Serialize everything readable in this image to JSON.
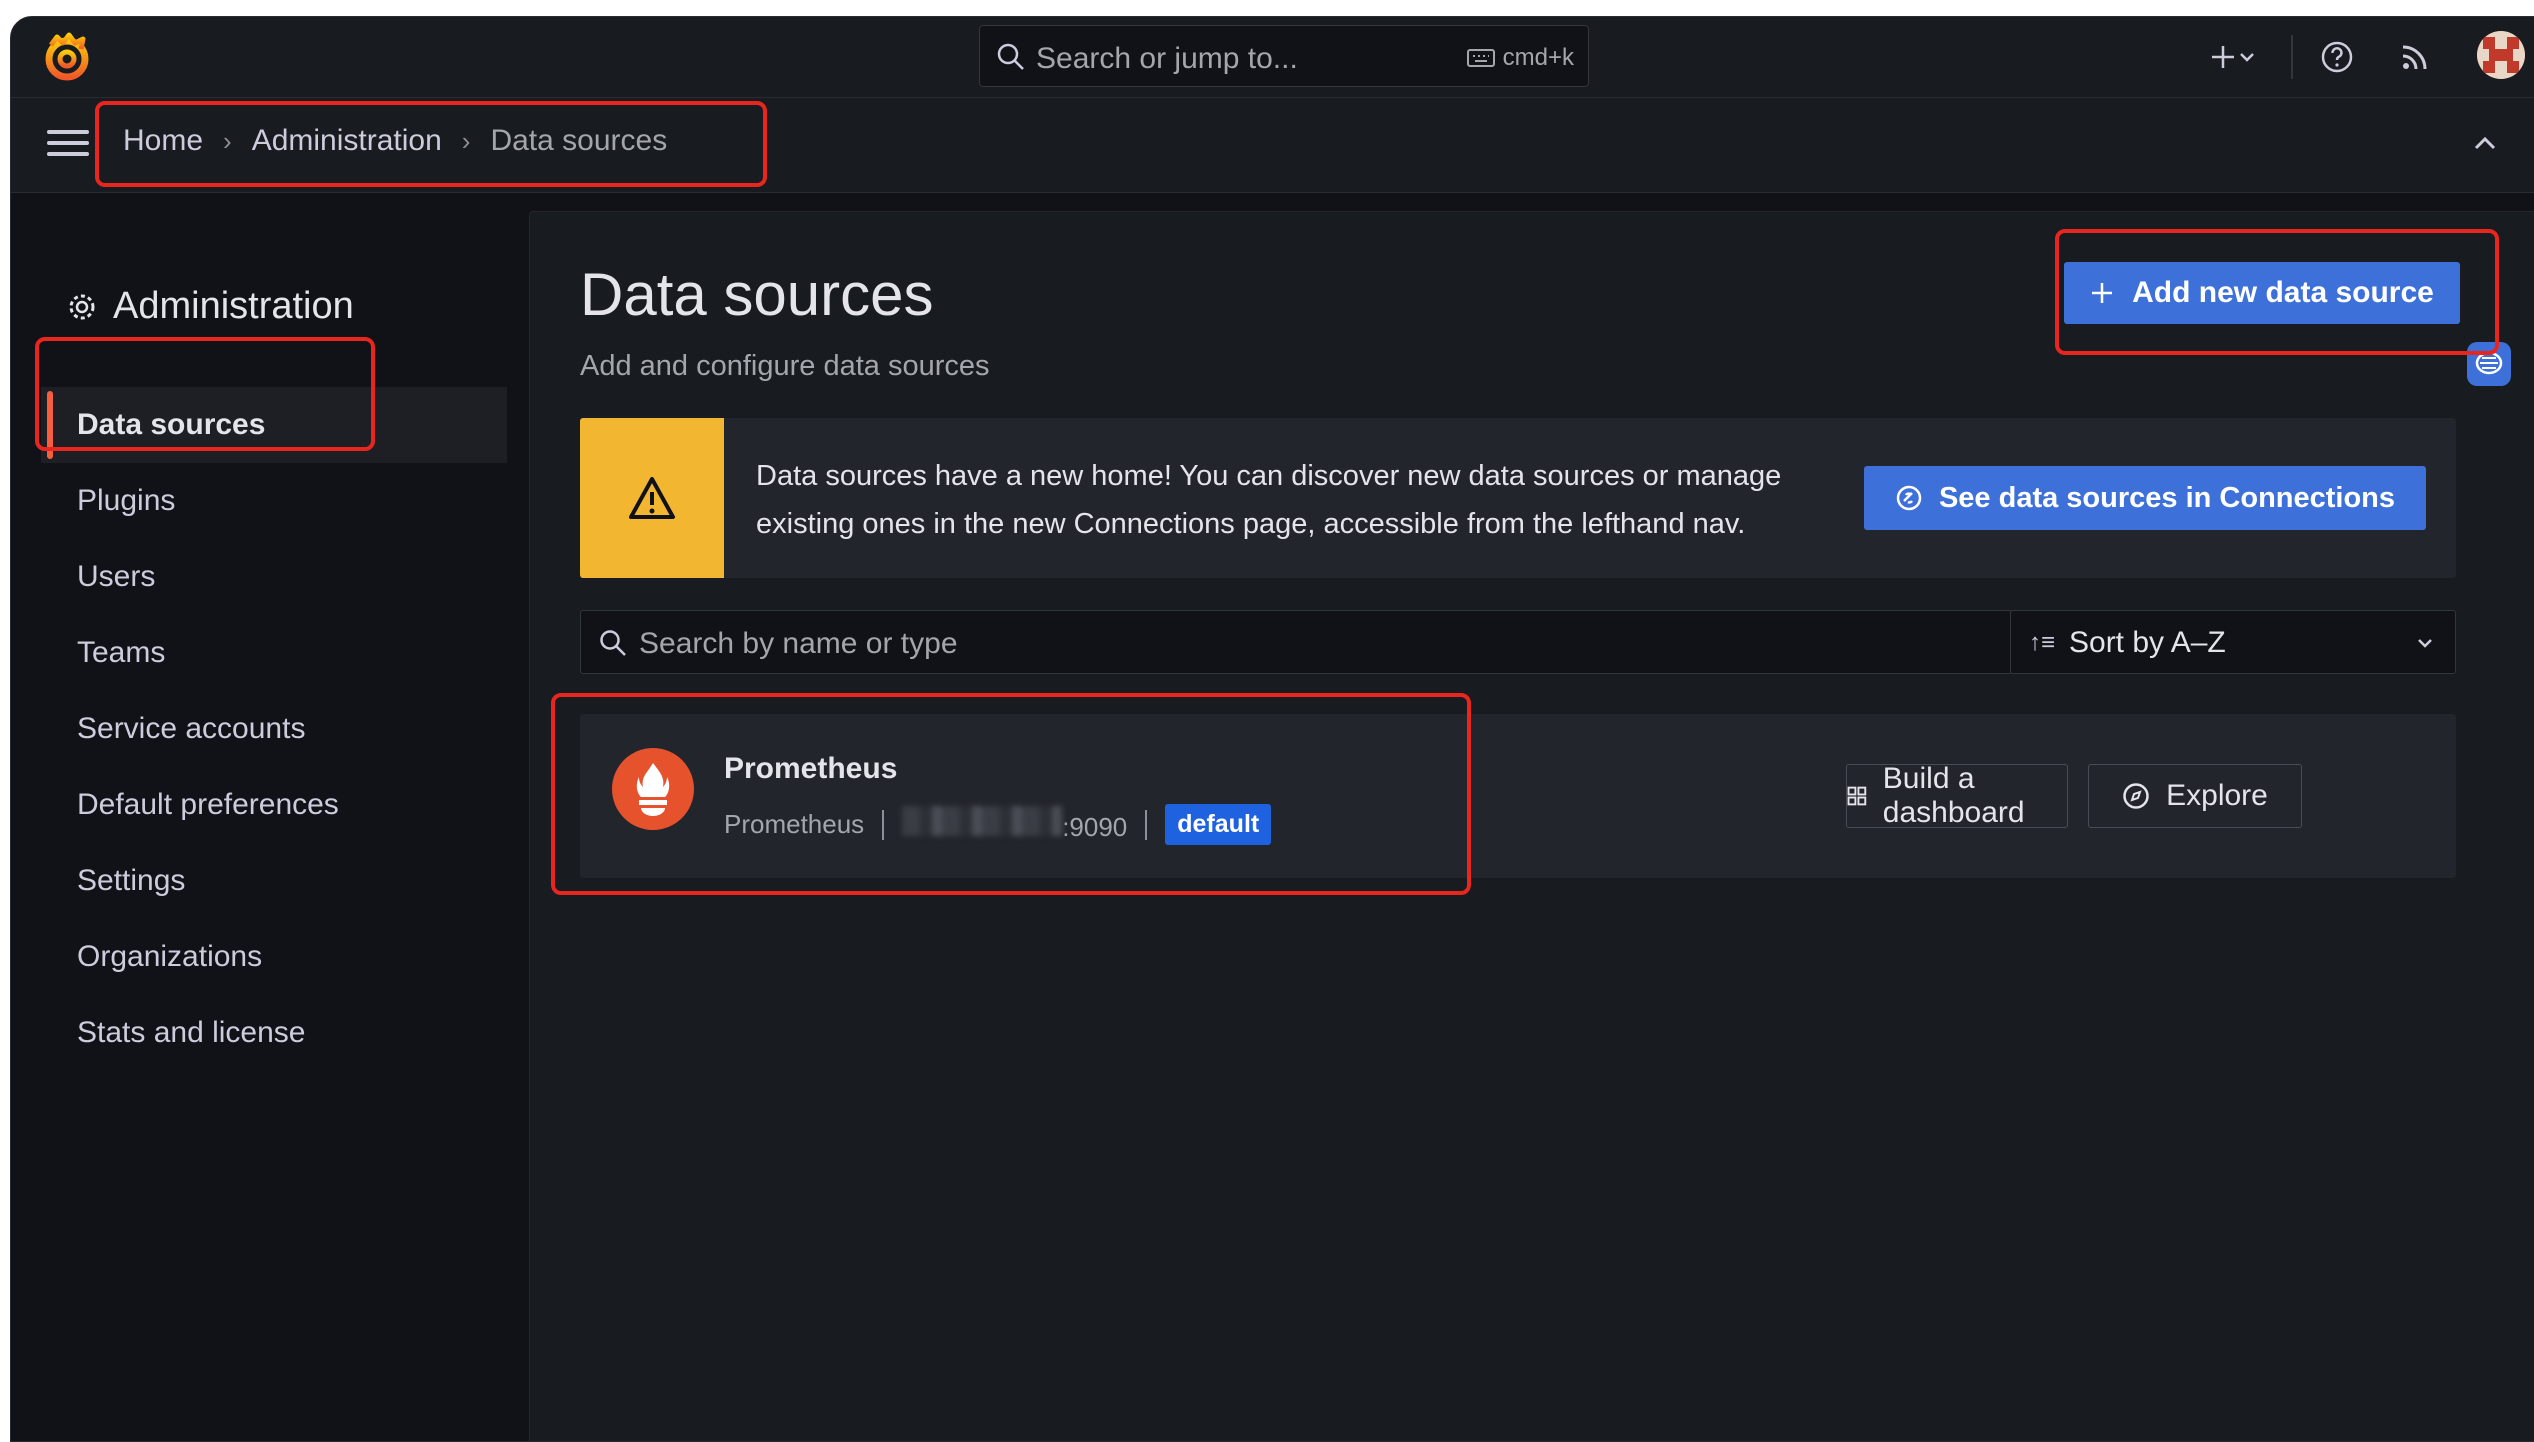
{
  "topbar": {
    "search_placeholder": "Search or jump to...",
    "search_shortcut": "cmd+k"
  },
  "breadcrumb": [
    "Home",
    "Administration",
    "Data sources"
  ],
  "sidebar": {
    "title": "Administration",
    "items": [
      {
        "label": "Data sources",
        "active": true
      },
      {
        "label": "Plugins"
      },
      {
        "label": "Users"
      },
      {
        "label": "Teams"
      },
      {
        "label": "Service accounts"
      },
      {
        "label": "Default preferences"
      },
      {
        "label": "Settings"
      },
      {
        "label": "Organizations"
      },
      {
        "label": "Stats and license"
      }
    ]
  },
  "main": {
    "title": "Data sources",
    "subtitle": "Add and configure data sources",
    "add_button": "Add new data source",
    "alert": {
      "text": "Data sources have a new home! You can discover new data sources or manage existing ones in the new Connections page, accessible from the lefthand nav.",
      "button": "See data sources in Connections"
    },
    "search_placeholder": "Search by name or type",
    "sort_label": "Sort by A–Z",
    "datasources": [
      {
        "name": "Prometheus",
        "type": "Prometheus",
        "url_suffix": ":9090",
        "badge": "default",
        "actions": [
          "Build a dashboard",
          "Explore"
        ]
      }
    ]
  },
  "colors": {
    "accent": "#3d71d9",
    "warning": "#f2b630",
    "active_indicator": "#f55f3e",
    "highlight_box": "#e8261e",
    "prometheus": "#e6522c"
  }
}
